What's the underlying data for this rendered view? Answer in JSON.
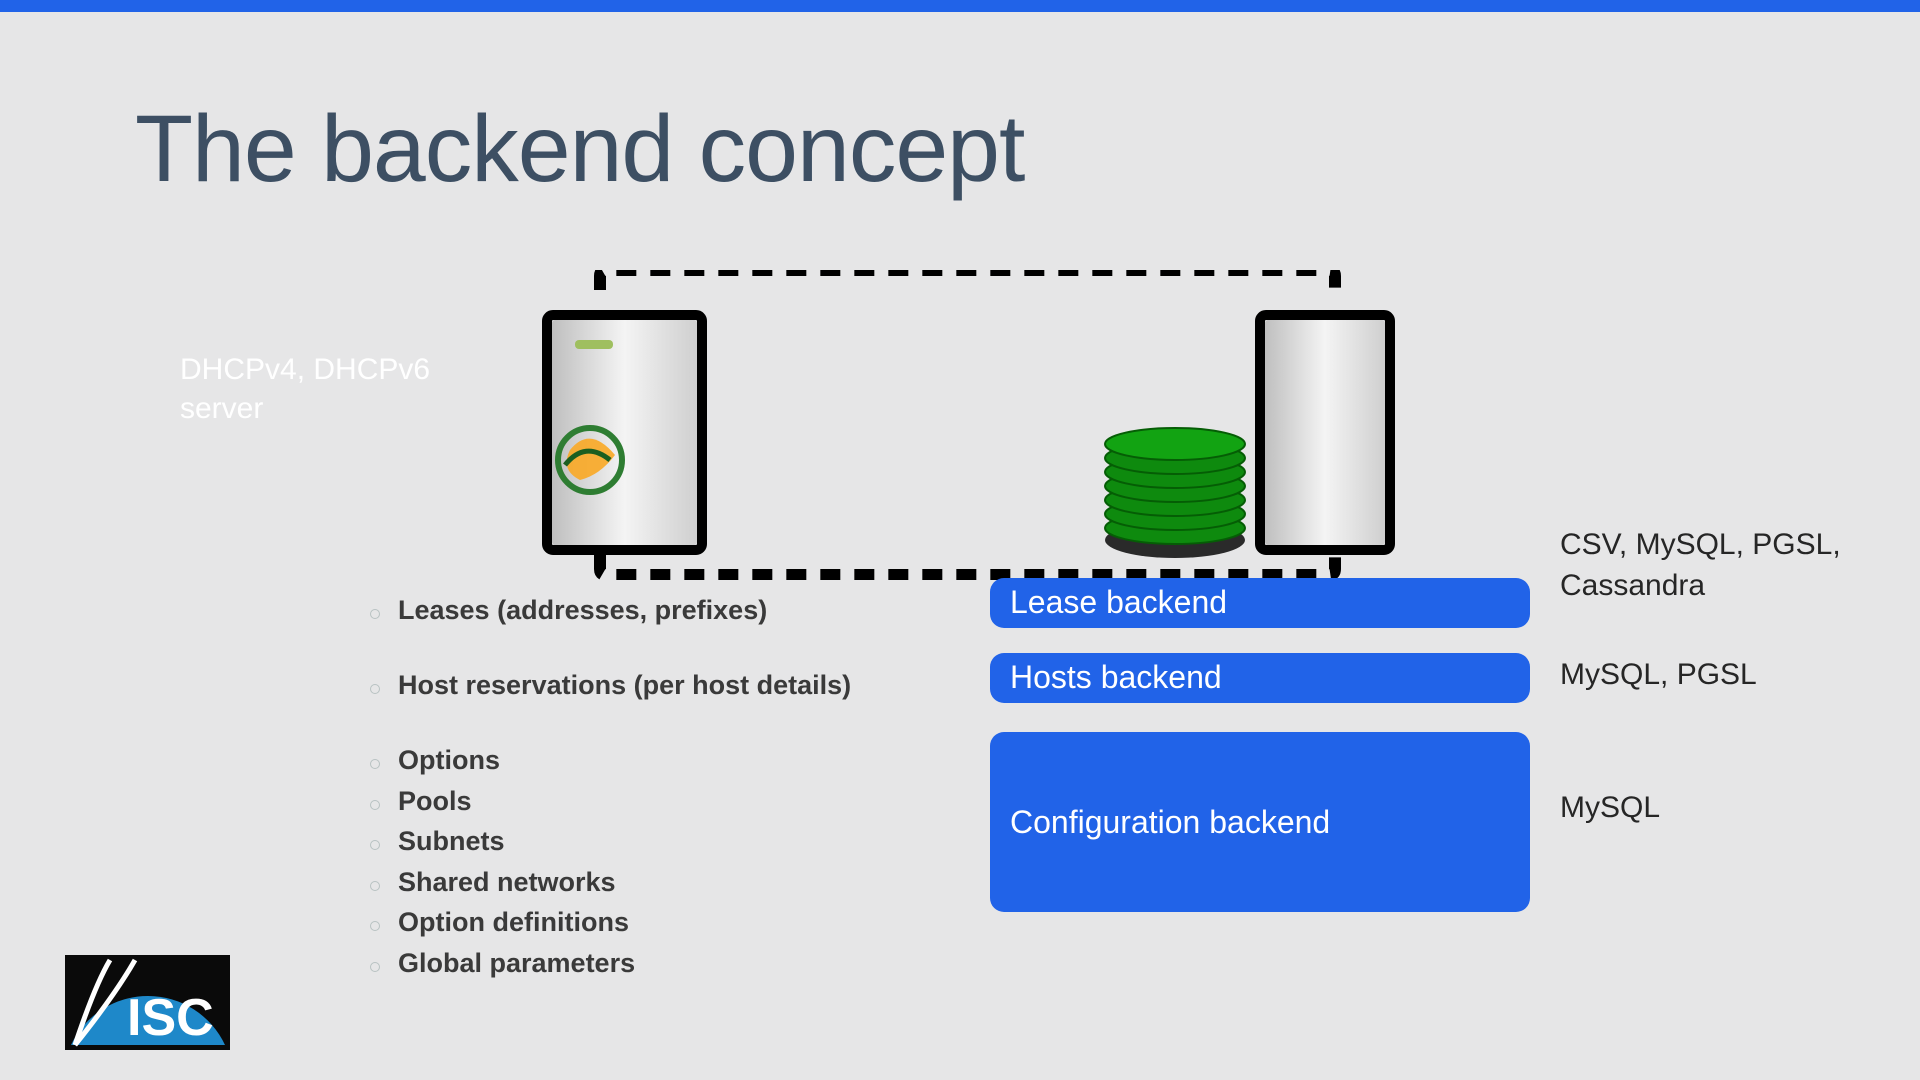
{
  "title": "The backend concept",
  "server_label": "DHCPv4, DHCPv6 server",
  "lists": {
    "leases": [
      "Leases (addresses, prefixes)"
    ],
    "hosts": [
      "Host reservations (per host details)"
    ],
    "config": [
      "Options",
      "Pools",
      "Subnets",
      "Shared networks",
      "Option definitions",
      "Global parameters"
    ]
  },
  "backends": {
    "lease": "Lease backend",
    "hosts": "Hosts backend",
    "config": "Configuration backend"
  },
  "tech": {
    "lease": "CSV, MySQL, PGSL, Cassandra",
    "hosts": "MySQL, PGSL",
    "config": "MySQL"
  },
  "logo_text": "ISC"
}
